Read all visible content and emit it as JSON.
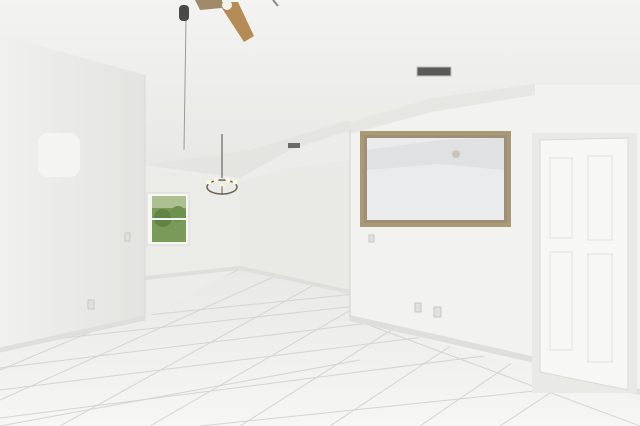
{
  "scene": {
    "kind": "empty interior room",
    "colors": {
      "ceiling": "#f1f1ef",
      "wall_light": "#f4f4f2",
      "wall_shade": "#e6e6e3",
      "floor": "#f2f2f0",
      "grout": "#d4d4d1",
      "mirror_frame": "#a89a78",
      "mirror_glass": "#e9ebec",
      "door": "#f7f7f5",
      "window_glass": "#7a9a5a",
      "fan_blade": "#b48a55"
    }
  }
}
